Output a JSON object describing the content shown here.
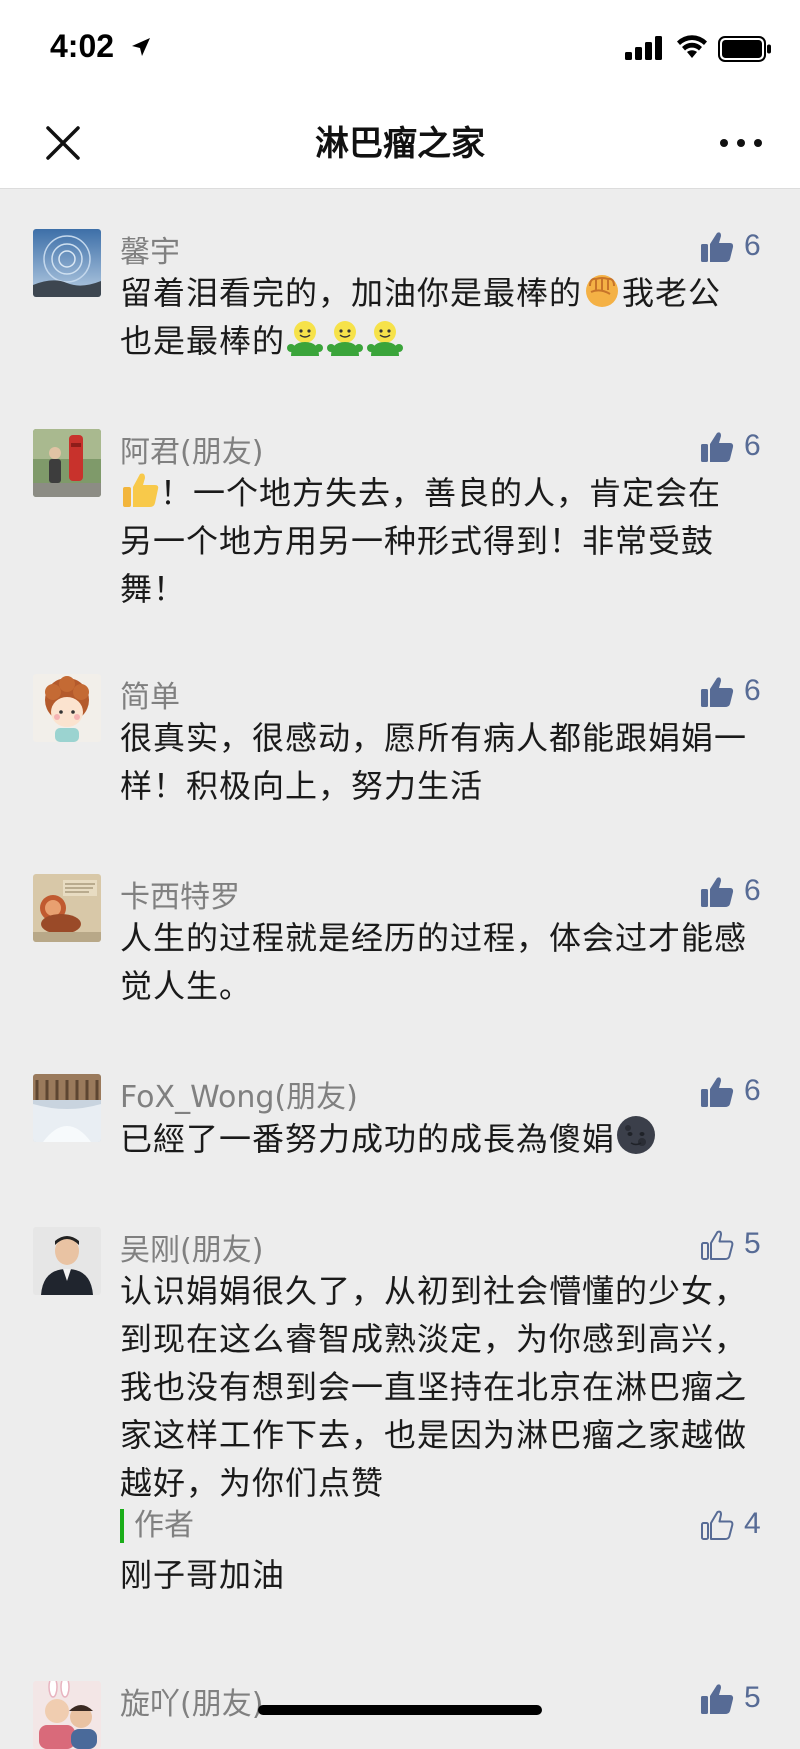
{
  "status_bar": {
    "time": "4:02"
  },
  "nav": {
    "title": "淋巴瘤之家"
  },
  "comments": [
    {
      "name": "馨宇",
      "likes": "6",
      "liked": true,
      "text_1": "留着泪看完的，加油你是最棒的",
      "text_2": "我老公也是最棒的",
      "emojis": [
        "fist-emoji",
        "smile-emoji",
        "smile-emoji",
        "smile-emoji"
      ]
    },
    {
      "name": "阿君(朋友)",
      "likes": "6",
      "liked": true,
      "text": "！一个地方失去，善良的人，肯定会在另一个地方用另一种形式得到！非常受鼓舞！",
      "emojis": [
        "thumbs-up-emoji"
      ]
    },
    {
      "name": "简单",
      "likes": "6",
      "liked": true,
      "text": "很真实，很感动，愿所有病人都能跟娟娟一样！积极向上，努力生活"
    },
    {
      "name": "卡西特罗",
      "likes": "6",
      "liked": true,
      "text": "人生的过程就是经历的过程，体会过才能感觉人生。"
    },
    {
      "name": "FoX_Wong(朋友)",
      "likes": "6",
      "liked": true,
      "text": "已經了一番努力成功的成長為傻娟",
      "emojis": [
        "new-moon-face-emoji"
      ]
    },
    {
      "name": "吴刚(朋友)",
      "likes": "5",
      "liked": false,
      "text": "认识娟娟很久了，从初到社会懵懂的少女，到现在这么睿智成熟淡定，为你感到高兴，我也没有想到会一直坚持在北京在淋巴瘤之家这样工作下去，也是因为淋巴瘤之家越做越好，为你们点赞",
      "author_reply": {
        "tag": "作者",
        "text": "刚子哥加油",
        "likes": "4",
        "liked": false
      }
    },
    {
      "name": "旋吖(朋友)",
      "likes": "5",
      "liked": true
    }
  ],
  "colors": {
    "link": "#576b95",
    "author_bar": "#1aad19",
    "background": "#ededed"
  }
}
